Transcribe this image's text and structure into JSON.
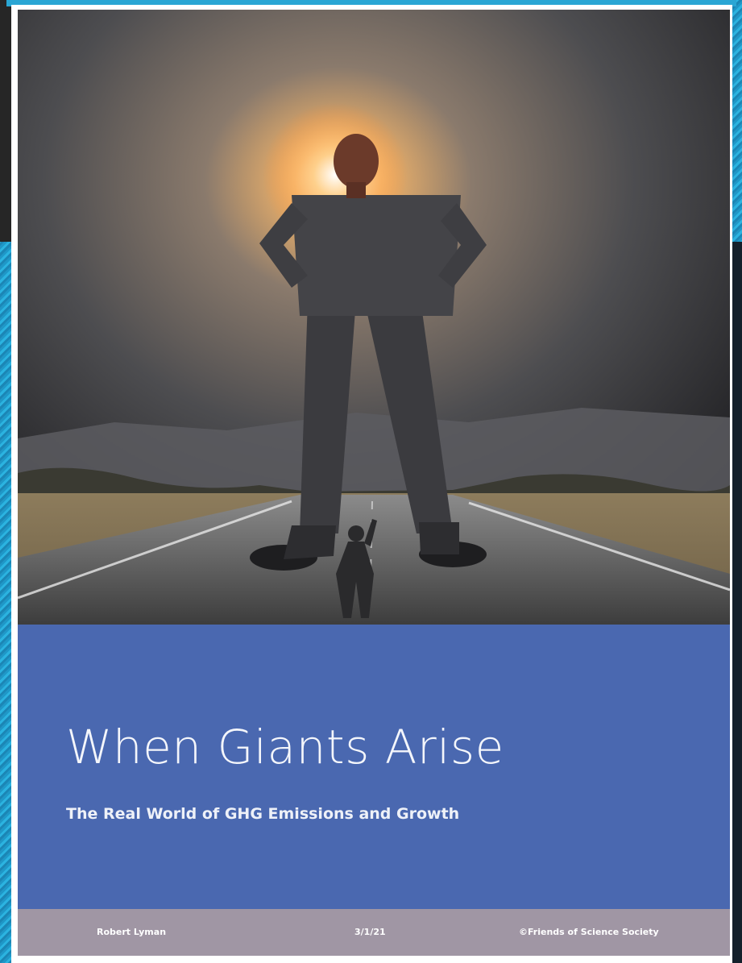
{
  "cover": {
    "image_alt": "Giant businessman standing over a small man on a road",
    "title": "When Giants Arise",
    "subtitle": "The Real World of GHG Emissions and Growth"
  },
  "footer": {
    "author": "Robert Lyman",
    "date": "3/1/21",
    "copyright": "©Friends of Science Society"
  },
  "colors": {
    "title_band": "#4a68b0",
    "footer_band": "#a096a4",
    "side_strip": "#2aa6d4"
  }
}
